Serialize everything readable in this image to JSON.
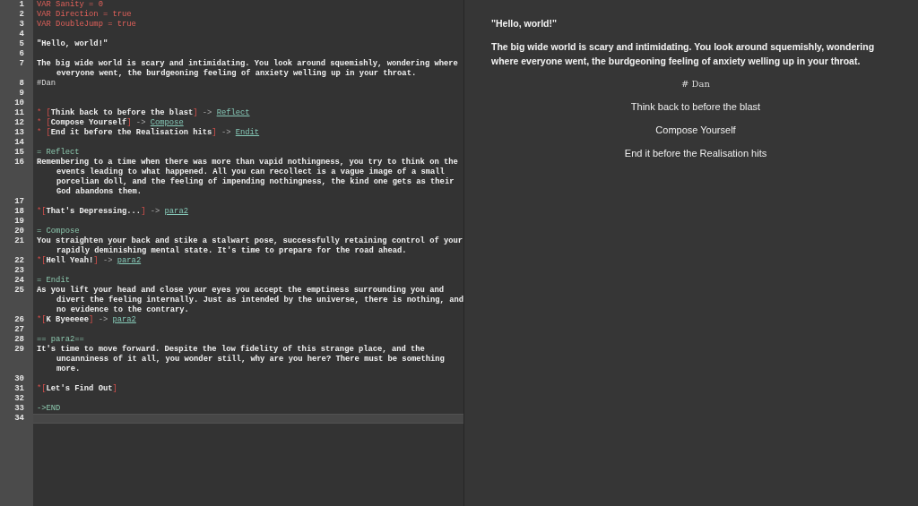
{
  "editor": {
    "lines": [
      {
        "number": "1",
        "current": false,
        "segments": [
          {
            "kind": "var",
            "text": "VAR Sanity = 0"
          }
        ]
      },
      {
        "number": "2",
        "current": false,
        "segments": [
          {
            "kind": "var",
            "text": "VAR Direction = true"
          }
        ]
      },
      {
        "number": "3",
        "current": false,
        "segments": [
          {
            "kind": "var",
            "text": "VAR DoubleJump = true"
          }
        ]
      },
      {
        "number": "4",
        "current": false
      },
      {
        "number": "5",
        "current": false,
        "segments": [
          {
            "kind": "text",
            "text": "\"Hello, world!\""
          }
        ]
      },
      {
        "number": "6",
        "current": false
      },
      {
        "number": "7",
        "current": false,
        "segments": [
          {
            "kind": "text",
            "text": "The big wide world is scary and intimidating. You look around squemishly, wondering where everyone went, the burdgeoning feeling of anxiety welling up in your throat."
          }
        ]
      },
      {
        "number": "8",
        "current": false,
        "segments": [
          {
            "kind": "tag",
            "text": "#Dan"
          }
        ]
      },
      {
        "number": "9",
        "current": false
      },
      {
        "number": "10",
        "current": false
      },
      {
        "number": "11",
        "current": false,
        "segments": [
          {
            "kind": "bullet",
            "text": "* ["
          },
          {
            "kind": "text",
            "text": "Think back to before the blast"
          },
          {
            "kind": "bracket",
            "text": "]"
          },
          {
            "kind": "arrow",
            "text": " -> "
          },
          {
            "kind": "link",
            "text": "Reflect"
          }
        ]
      },
      {
        "number": "12",
        "current": false,
        "segments": [
          {
            "kind": "bullet",
            "text": "* ["
          },
          {
            "kind": "text",
            "text": "Compose Yourself"
          },
          {
            "kind": "bracket",
            "text": "]"
          },
          {
            "kind": "arrow",
            "text": " -> "
          },
          {
            "kind": "link",
            "text": "Compose"
          }
        ]
      },
      {
        "number": "13",
        "current": false,
        "segments": [
          {
            "kind": "bullet",
            "text": "* ["
          },
          {
            "kind": "text",
            "text": "End it before the Realisation hits"
          },
          {
            "kind": "bracket",
            "text": "]"
          },
          {
            "kind": "arrow",
            "text": " -> "
          },
          {
            "kind": "link",
            "text": "Endit"
          }
        ]
      },
      {
        "number": "14",
        "current": false
      },
      {
        "number": "15",
        "current": false,
        "segments": [
          {
            "kind": "knot",
            "text": "= Reflect"
          }
        ]
      },
      {
        "number": "16",
        "current": false,
        "segments": [
          {
            "kind": "text",
            "text": "Remembering to a time when there was more than vapid nothingness, you try to think on the events leading to what happened. All you can recollect is a vague image of a small porcelian doll, and the feeling of impending nothingness, the kind one gets as their God abandons them."
          }
        ]
      },
      {
        "number": "17",
        "current": false
      },
      {
        "number": "18",
        "current": false,
        "segments": [
          {
            "kind": "bullet",
            "text": "*["
          },
          {
            "kind": "text",
            "text": "That's Depressing..."
          },
          {
            "kind": "bracket",
            "text": "]"
          },
          {
            "kind": "arrow",
            "text": " -> "
          },
          {
            "kind": "link",
            "text": "para2"
          }
        ]
      },
      {
        "number": "19",
        "current": false
      },
      {
        "number": "20",
        "current": false,
        "segments": [
          {
            "kind": "knot",
            "text": "= Compose"
          }
        ]
      },
      {
        "number": "21",
        "current": false,
        "segments": [
          {
            "kind": "text",
            "text": "You straighten your back and stike a stalwart pose, successfully retaining control of your rapidly deminishing mental state. It's time to prepare for the road ahead."
          }
        ]
      },
      {
        "number": "22",
        "current": false,
        "segments": [
          {
            "kind": "bullet",
            "text": "*["
          },
          {
            "kind": "text",
            "text": "Hell Yeah!"
          },
          {
            "kind": "bracket",
            "text": "]"
          },
          {
            "kind": "arrow",
            "text": " -> "
          },
          {
            "kind": "link",
            "text": "para2"
          }
        ]
      },
      {
        "number": "23",
        "current": false
      },
      {
        "number": "24",
        "current": false,
        "segments": [
          {
            "kind": "knot",
            "text": "= Endit"
          }
        ]
      },
      {
        "number": "25",
        "current": false,
        "segments": [
          {
            "kind": "text",
            "text": "As you lift your head and close your eyes you accept the emptiness surrounding you and divert the feeling internally. Just as intended by the universe, there is nothing, and no evidence to the contrary."
          }
        ]
      },
      {
        "number": "26",
        "current": false,
        "segments": [
          {
            "kind": "bullet",
            "text": "*["
          },
          {
            "kind": "text",
            "text": "K Byeeeee"
          },
          {
            "kind": "bracket",
            "text": "]"
          },
          {
            "kind": "arrow",
            "text": " -> "
          },
          {
            "kind": "link",
            "text": "para2"
          }
        ]
      },
      {
        "number": "27",
        "current": false
      },
      {
        "number": "28",
        "current": false,
        "segments": [
          {
            "kind": "knot",
            "text": "== para2=="
          }
        ]
      },
      {
        "number": "29",
        "current": false,
        "segments": [
          {
            "kind": "text",
            "text": "It's time to move forward. Despite the low fidelity of this strange place, and the uncanniness of it all, you wonder still, why are you here? There must be something more."
          }
        ]
      },
      {
        "number": "30",
        "current": false
      },
      {
        "number": "31",
        "current": false,
        "segments": [
          {
            "kind": "bullet",
            "text": "*["
          },
          {
            "kind": "text",
            "text": "Let's Find Out"
          },
          {
            "kind": "bracket",
            "text": "]"
          }
        ]
      },
      {
        "number": "32",
        "current": false
      },
      {
        "number": "33",
        "current": false,
        "segments": [
          {
            "kind": "knot",
            "text": "->END"
          }
        ]
      },
      {
        "number": "34",
        "current": true
      }
    ]
  },
  "preview": {
    "items": [
      {
        "kind": "text",
        "text": "\"Hello, world!\""
      },
      {
        "kind": "text",
        "text": "The big wide world is scary and intimidating. You look around squemishly, wondering where everyone went, the burdgeoning feeling of anxiety welling up in your throat."
      },
      {
        "kind": "tag",
        "text": "# Dan"
      },
      {
        "kind": "choice",
        "text": "Think back to before the blast"
      },
      {
        "kind": "choice",
        "text": "Compose Yourself"
      },
      {
        "kind": "choice",
        "text": "End it before the Realisation hits"
      }
    ]
  }
}
